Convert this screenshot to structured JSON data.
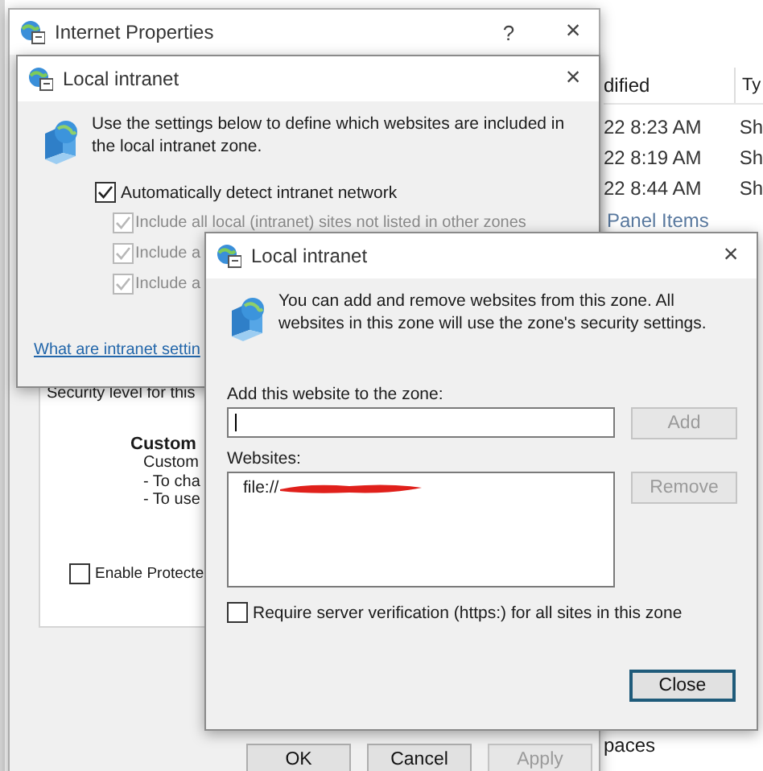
{
  "explorer": {
    "columns": [
      {
        "label": "dified"
      },
      {
        "label": "Ty"
      }
    ],
    "rows": [
      {
        "modified": "22 8:23 AM",
        "type": "Sh"
      },
      {
        "modified": "22 8:19 AM",
        "type": "Sh"
      },
      {
        "modified": "22 8:44 AM",
        "type": "Sh"
      }
    ],
    "group_heading": "Panel Items",
    "bottom_item": "paces"
  },
  "internet_properties": {
    "title": "Internet Properties",
    "help": "?",
    "close": "×",
    "security_label": "Security level for this",
    "level_name": "Custom",
    "level_lines": [
      "Custom",
      "- To cha",
      "- To use"
    ],
    "protected_mode": {
      "label": "Enable Protecte",
      "checked": false
    },
    "buttons": [
      {
        "label": "OK",
        "disabled": false
      },
      {
        "label": "Cancel",
        "disabled": false
      },
      {
        "label": "Apply",
        "disabled": true
      }
    ]
  },
  "intranet_dialog": {
    "title": "Local intranet",
    "close": "×",
    "description": "Use the settings below to define which websites are included in the local intranet zone.",
    "auto_detect": {
      "label": "Automatically detect intranet network",
      "checked": true,
      "disabled": false
    },
    "options": [
      {
        "label": "Include all local (intranet) sites not listed in other zones",
        "checked": true,
        "disabled": true
      },
      {
        "label": "Include a",
        "checked": true,
        "disabled": true
      },
      {
        "label": "Include a",
        "checked": true,
        "disabled": true
      }
    ],
    "link": "What are intranet settin"
  },
  "sites_dialog": {
    "title": "Local intranet",
    "close": "×",
    "description": "You can add and remove websites from this zone. All websites in this zone will use the zone's security settings.",
    "add_label": "Add this website to the zone:",
    "add_button": {
      "label": "Add",
      "disabled": true
    },
    "websites_label": "Websites:",
    "websites": [
      {
        "text": "file://",
        "redacted": true
      }
    ],
    "remove_button": {
      "label": "Remove",
      "disabled": true
    },
    "https_required": {
      "label": "Require server verification (https:) for all sites in this zone",
      "checked": false,
      "disabled": false
    },
    "close_button": {
      "label": "Close",
      "disabled": false,
      "focused": true
    }
  }
}
